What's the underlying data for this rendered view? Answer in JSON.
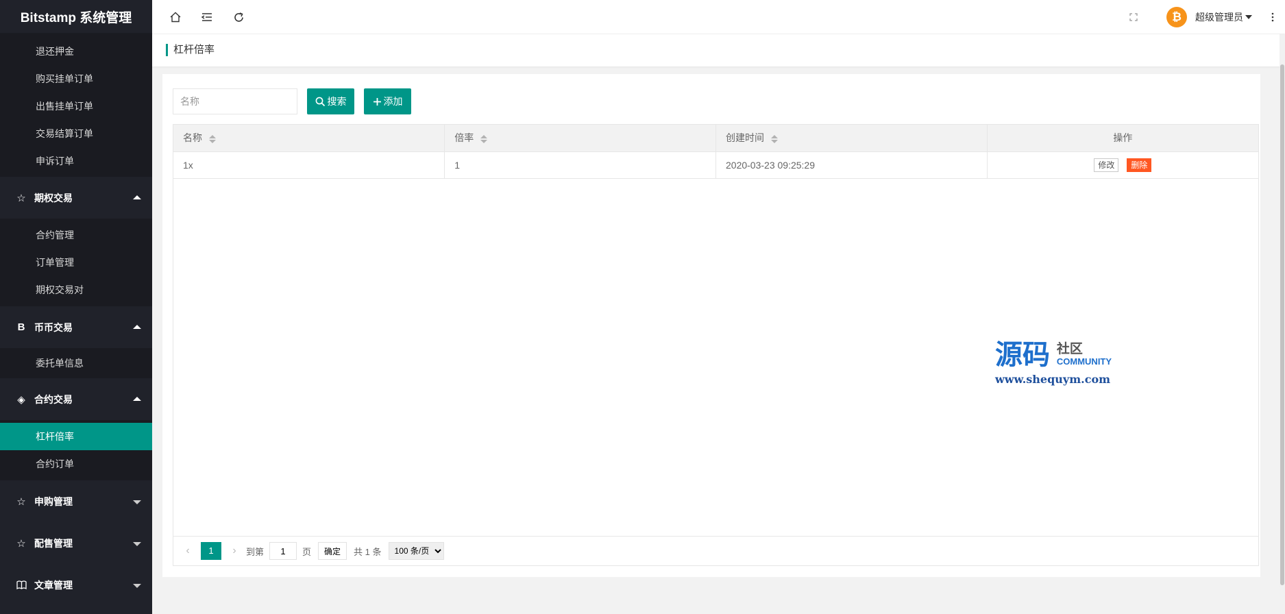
{
  "app": {
    "title": "Bitstamp 系统管理"
  },
  "sidebar": {
    "top_items": [
      {
        "label": "退还押金"
      },
      {
        "label": "购买挂单订单"
      },
      {
        "label": "出售挂单订单"
      },
      {
        "label": "交易结算订单"
      },
      {
        "label": "申诉订单"
      }
    ],
    "groups": [
      {
        "label": "期权交易",
        "icon": "star-icon",
        "expanded": true,
        "items": [
          {
            "label": "合约管理"
          },
          {
            "label": "订单管理"
          },
          {
            "label": "期权交易对"
          }
        ]
      },
      {
        "label": "币币交易",
        "icon": "b-icon",
        "expanded": true,
        "items": [
          {
            "label": "委托单信息"
          }
        ]
      },
      {
        "label": "合约交易",
        "icon": "diamond-icon",
        "expanded": true,
        "items": [
          {
            "label": "杠杆倍率",
            "active": true
          },
          {
            "label": "合约订单"
          }
        ]
      },
      {
        "label": "申购管理",
        "icon": "star-icon",
        "expanded": false
      },
      {
        "label": "配售管理",
        "icon": "star-icon",
        "expanded": false
      },
      {
        "label": "文章管理",
        "icon": "book-icon",
        "expanded": false
      }
    ]
  },
  "header": {
    "icons": [
      "home-icon",
      "menu-fold-icon",
      "refresh-icon",
      "fullscreen-icon",
      "more-icon"
    ],
    "user": {
      "avatar_glyph": "₿",
      "name": "超级管理员"
    }
  },
  "tab": {
    "title": "杠杆倍率"
  },
  "toolbar": {
    "search_placeholder": "名称",
    "search_label": "搜索",
    "add_label": "添加"
  },
  "table": {
    "columns": [
      {
        "label": "名称",
        "sortable": true
      },
      {
        "label": "倍率",
        "sortable": true
      },
      {
        "label": "创建时间",
        "sortable": true
      },
      {
        "label": "操作",
        "sortable": false
      }
    ],
    "rows": [
      {
        "name": "1x",
        "rate": "1",
        "created": "2020-03-23 09:25:29",
        "edit_label": "修改",
        "delete_label": "删除"
      }
    ]
  },
  "pager": {
    "current": "1",
    "goto_label": "到第",
    "goto_value": "1",
    "page_unit": "页",
    "ok_label": "确定",
    "total_label": "共 1 条",
    "page_size": "100 条/页"
  },
  "watermark": {
    "big": "源码",
    "side": "社区",
    "community": "COMMUNITY",
    "url": "www.shequym.com"
  },
  "colors": {
    "accent": "#009688",
    "danger": "#ff5722",
    "sidebar": "#20222a"
  }
}
